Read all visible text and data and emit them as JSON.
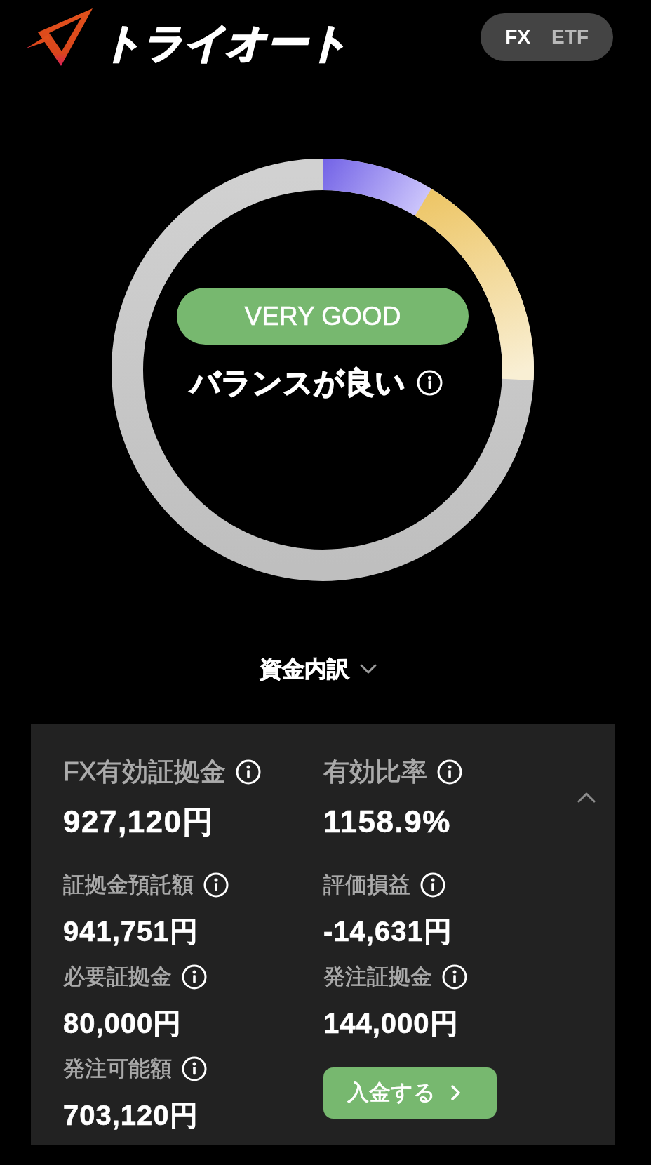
{
  "header": {
    "logo": "トライオート",
    "market_tabs": [
      {
        "label": "FX",
        "selected": true
      },
      {
        "label": "ETF",
        "selected": false
      }
    ]
  },
  "gauge": {
    "rating": "VERY GOOD",
    "status": "バランスが良い"
  },
  "breakdown": {
    "title": "資金内訳",
    "expanded": true,
    "primary": [
      {
        "label": "FX有効証拠金",
        "value": "927,120円"
      },
      {
        "label": "有効比率",
        "value": "1158.9%"
      }
    ],
    "details": [
      {
        "label": "証拠金預託額",
        "value": "941,751円"
      },
      {
        "label": "評価損益",
        "value": "-14,631円"
      },
      {
        "label": "必要証拠金",
        "value": "80,000円"
      },
      {
        "label": "発注証拠金",
        "value": "144,000円"
      },
      {
        "label": "発注可能額",
        "value": "703,120円"
      }
    ],
    "deposit_button": {
      "label": "入金する"
    }
  }
}
